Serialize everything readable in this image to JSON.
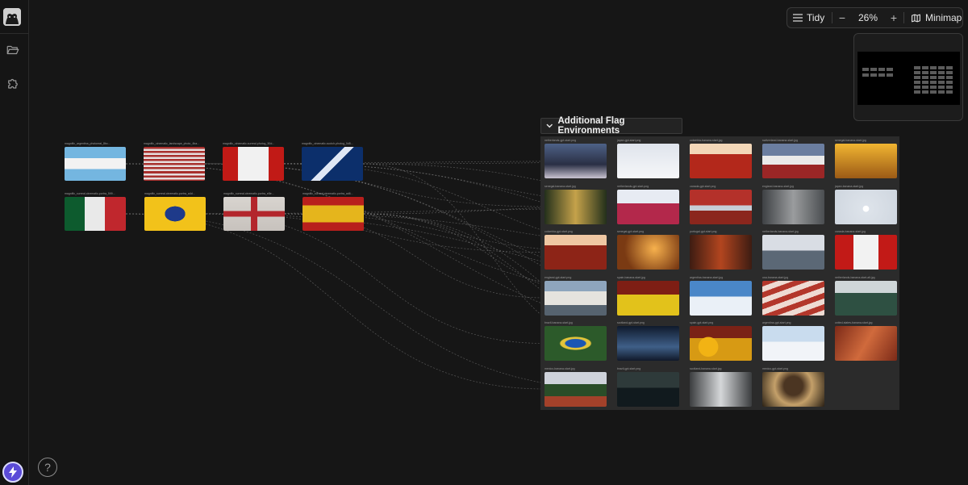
{
  "toolbar": {
    "tidy_label": "Tidy",
    "zoom_out": "−",
    "zoom_value": "26%",
    "zoom_in": "+",
    "minimap_label": "Minimap"
  },
  "rail": {
    "help_label": "?"
  },
  "group": {
    "title": "Additional Flag Environments"
  },
  "source_nodes": [
    {
      "caption": "magnific_argentina_photoreal_8bc...",
      "theme": "argentina"
    },
    {
      "caption": "magnific_cinematic_landscape_photo_4ba...",
      "theme": "usa"
    },
    {
      "caption": "magnific_cinematic-surreal-photog_50d...",
      "theme": "canada"
    },
    {
      "caption": "magnific_cinematic-scotch-photog_0d8...",
      "theme": "scotland"
    },
    {
      "caption": "magnific_surreal-cinematic-portra_599...",
      "theme": "mexico"
    },
    {
      "caption": "magnific_surreal-cinematic-portra_a4d...",
      "theme": "brazil"
    },
    {
      "caption": "magnific_surreal-cinematic-portra_e8e...",
      "theme": "england"
    },
    {
      "caption": "magnific_surreal-cinematic-portra_ad6...",
      "theme": "spain"
    }
  ],
  "grid_nodes": [
    {
      "caption": "netherlands-gpt-start.png",
      "theme": "mist-mountain"
    },
    {
      "caption": "japan-gpt-start.png",
      "theme": "white-haze"
    },
    {
      "caption": "colombia-banana-start.jpg",
      "theme": "red-field"
    },
    {
      "caption": "switzerland-banana-start.jpg",
      "theme": "snow-red"
    },
    {
      "caption": "senegal-banana-start.jpg",
      "theme": "golden-trees"
    },
    {
      "caption": "senegal-banana-start.jpg",
      "theme": "forest-sunset"
    },
    {
      "caption": "netherlands-gpt-start.png",
      "theme": "tulips"
    },
    {
      "caption": "canada-gpt-start.png",
      "theme": "red-lake"
    },
    {
      "caption": "england-banana-start.jpg",
      "theme": "cliff-grey"
    },
    {
      "caption": "japan-banana-start.jpg",
      "theme": "pale-sun"
    },
    {
      "caption": "colombia-gpt-start.png",
      "theme": "red-ground"
    },
    {
      "caption": "senegal-gpt-start.png",
      "theme": "sunset-tree"
    },
    {
      "caption": "portugal-gpt-start.png",
      "theme": "red-arches"
    },
    {
      "caption": "netherlands-banana-start.jpg",
      "theme": "misty-lake"
    },
    {
      "caption": "canada-banana-start.jpg",
      "theme": "maple-red"
    },
    {
      "caption": "england-gpt-start.png",
      "theme": "white-cliffs"
    },
    {
      "caption": "spain-banana-start.jpg",
      "theme": "yellow-field"
    },
    {
      "caption": "argentina-banana-start.jpg",
      "theme": "salt-flat"
    },
    {
      "caption": "usa-banana-start.jpg",
      "theme": "red-stripes"
    },
    {
      "caption": "netherlands-banana-start-alt.jpg",
      "theme": "green-marsh"
    },
    {
      "caption": "brazil-banana-start.jpg",
      "theme": "blue-eye"
    },
    {
      "caption": "scotland-gpt-start.png",
      "theme": "night-river"
    },
    {
      "caption": "spain-gpt-start.png",
      "theme": "sunflowers"
    },
    {
      "caption": "argentina-gpt-start.png",
      "theme": "pale-salt"
    },
    {
      "caption": "united-states-banana-start.jpg",
      "theme": "red-canyon"
    },
    {
      "caption": "mexico-banana-start.jpg",
      "theme": "volcano"
    },
    {
      "caption": "brazil-gpt-start.png",
      "theme": "dark-lake"
    },
    {
      "caption": "scotland-banana-start.jpg",
      "theme": "waterfall"
    },
    {
      "caption": "mexico-gpt-start.png",
      "theme": "eagle"
    }
  ],
  "colors": {
    "canvas": "#161616",
    "group_body": "#2b2b2b",
    "edge": "#8a8a8a",
    "accent": "#5b4bd8"
  }
}
